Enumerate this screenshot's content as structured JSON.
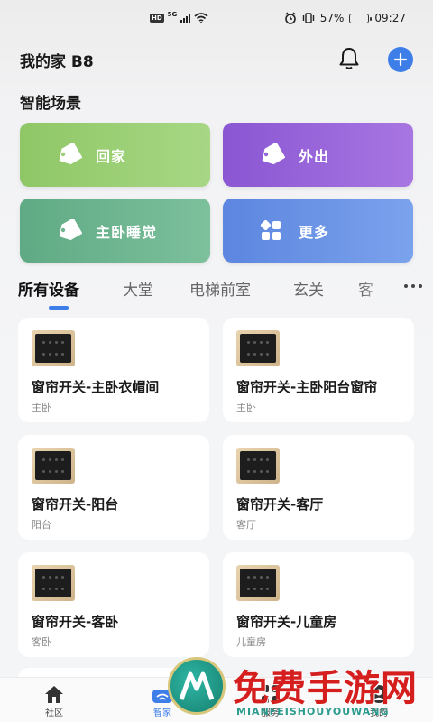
{
  "status_bar": {
    "network_badge": "HD",
    "network_type": "5G",
    "battery_percent": "57%",
    "battery_level": 0.57,
    "time": "09:27"
  },
  "header": {
    "title": "我的家 B8",
    "bell_icon": "bell-icon",
    "add_icon": "plus-icon"
  },
  "scenes": {
    "title": "智能场景",
    "items": [
      {
        "label": "回家",
        "icon": "tag-icon"
      },
      {
        "label": "外出",
        "icon": "tag-icon"
      },
      {
        "label": "主卧睡觉",
        "icon": "tag-icon"
      },
      {
        "label": "更多",
        "icon": "grid-icon"
      }
    ]
  },
  "tabs": {
    "items": [
      "所有设备",
      "大堂",
      "电梯前室",
      "玄关",
      "客"
    ],
    "active_index": 0
  },
  "devices": [
    {
      "name": "窗帘开关-主卧衣帽间",
      "room": "主卧"
    },
    {
      "name": "窗帘开关-主卧阳台窗帘",
      "room": "主卧"
    },
    {
      "name": "窗帘开关-阳台",
      "room": "阳台"
    },
    {
      "name": "窗帘开关-客厅",
      "room": "客厅"
    },
    {
      "name": "窗帘开关-客卧",
      "room": "客卧"
    },
    {
      "name": "窗帘开关-儿童房",
      "room": "儿童房"
    }
  ],
  "bottom_nav": [
    {
      "label": "社区",
      "icon": "home-icon"
    },
    {
      "label": "智家",
      "icon": "wifi-home-icon"
    },
    {
      "label": "服务",
      "icon": "grid-icon"
    },
    {
      "label": "我的",
      "icon": "person-icon"
    }
  ],
  "watermark": {
    "text": "免费手游网",
    "sub": "MIANFEISHOUYOUWANG"
  },
  "colors": {
    "accent": "#3d7ee8",
    "scene_home": "#8fc766",
    "scene_out": "#8a56d2",
    "scene_sleep": "#5faa84",
    "scene_more": "#5c86e0",
    "watermark_red": "#d51f1f"
  }
}
